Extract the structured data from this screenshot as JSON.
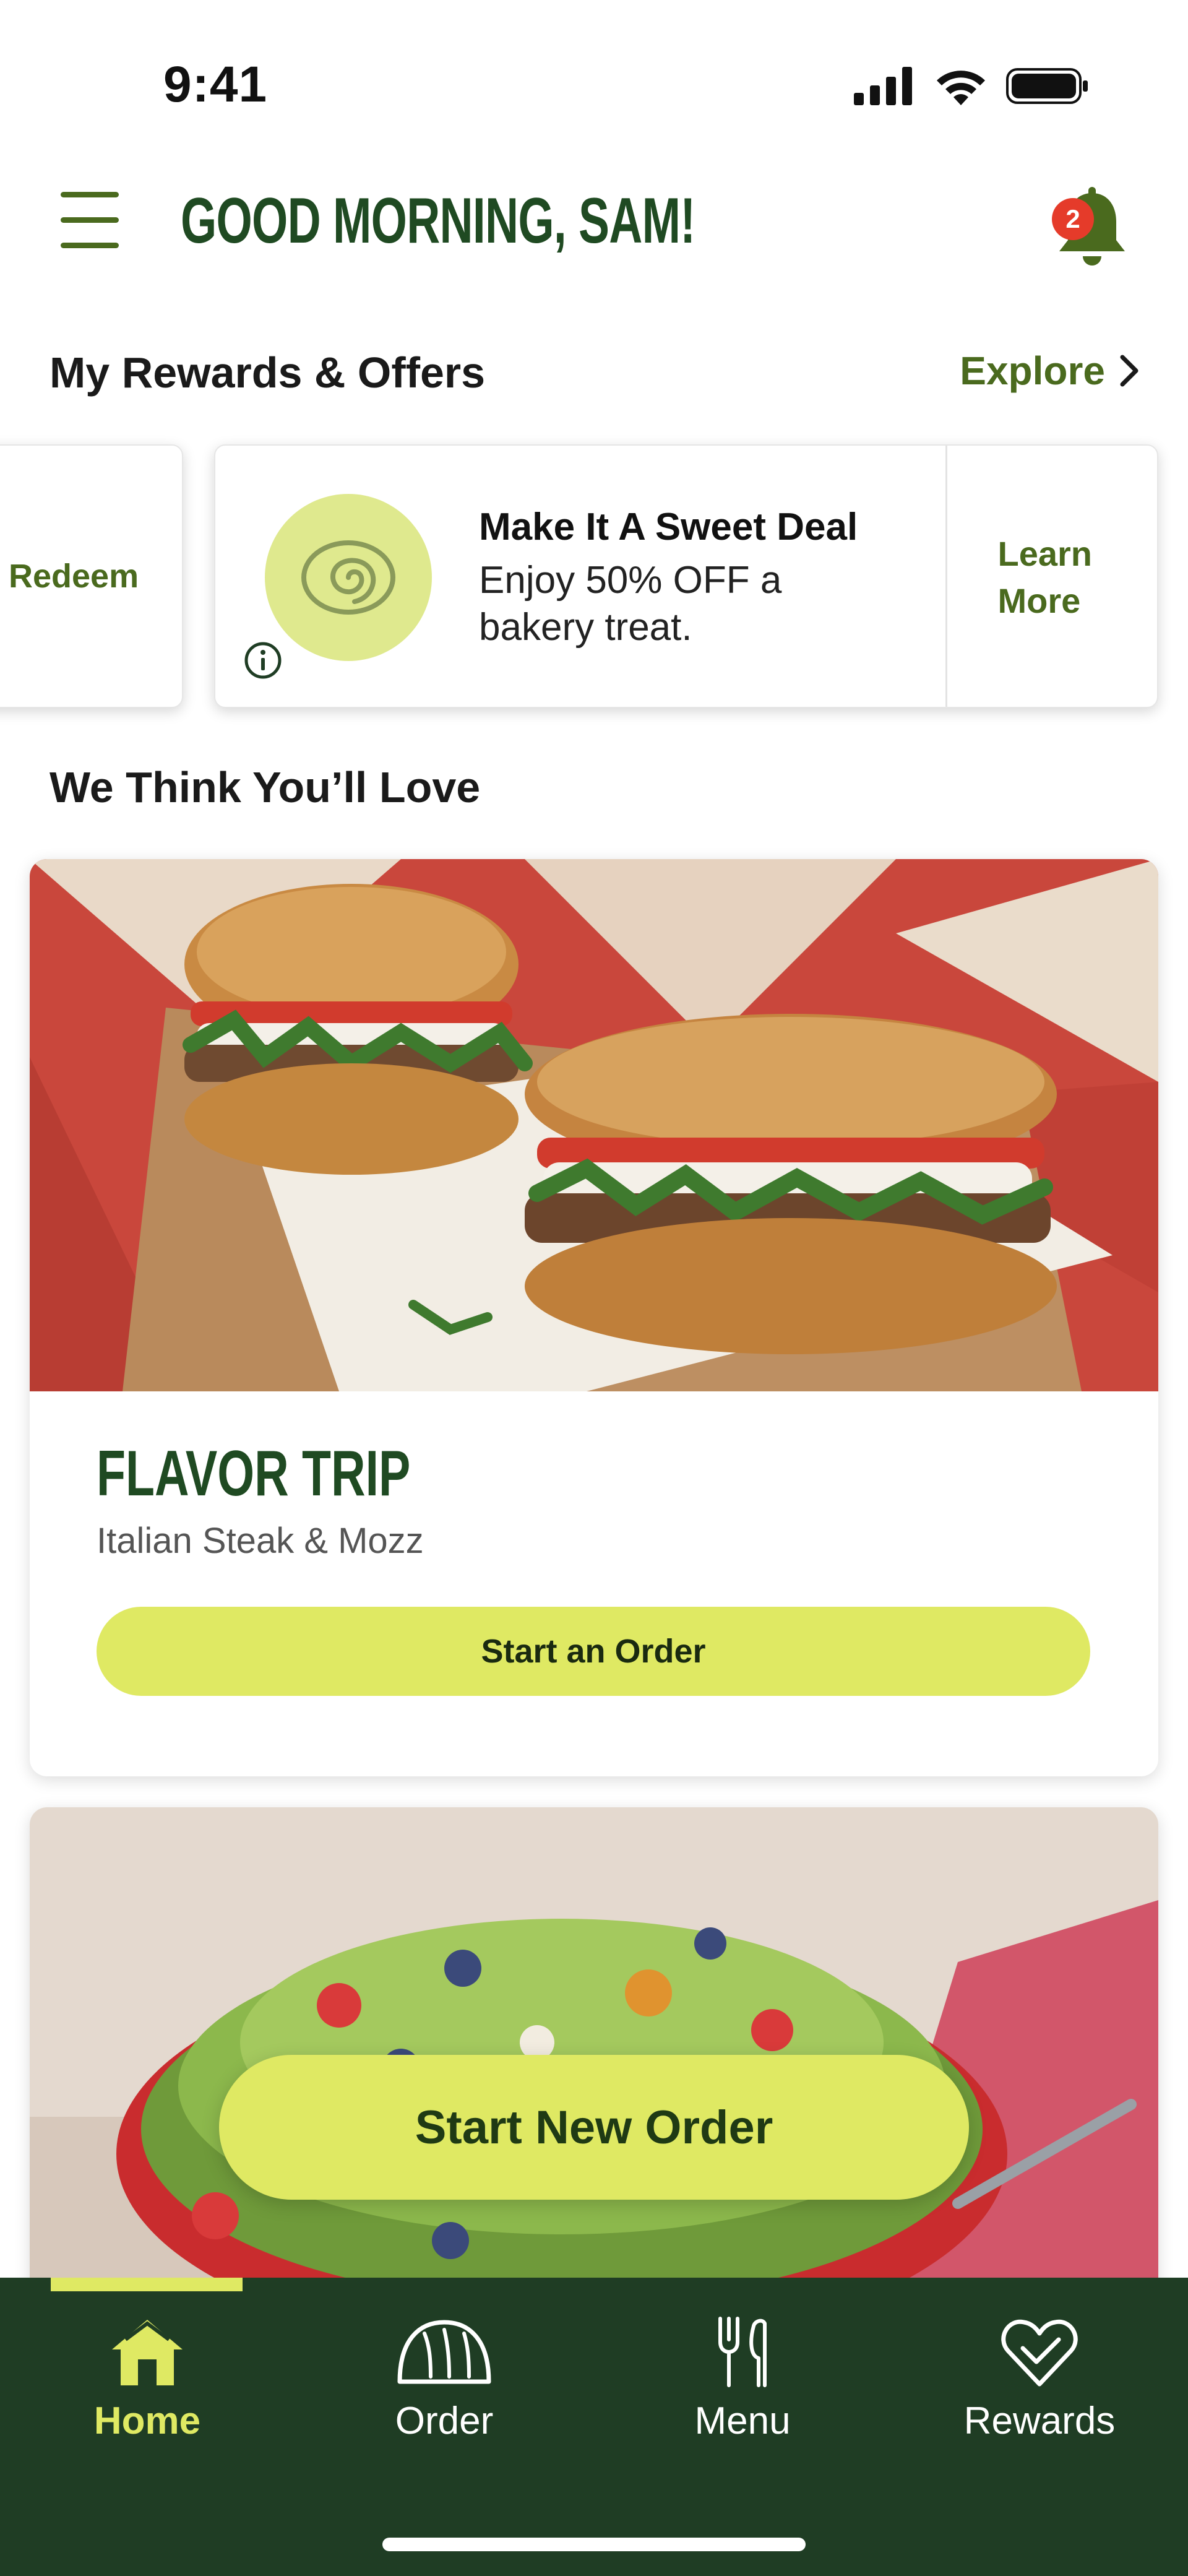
{
  "status_bar": {
    "time": "9:41"
  },
  "header": {
    "greeting": "GOOD MORNING, SAM!",
    "notification_count": "2"
  },
  "rewards": {
    "title": "My Rewards & Offers",
    "explore_label": "Explore",
    "left_card_action": "Redeem",
    "offer": {
      "title": "Make It A Sweet Deal",
      "description": "Enjoy 50% OFF a bakery treat.",
      "cta": "Learn More"
    }
  },
  "recommendations": {
    "title": "We Think You’ll Love",
    "cards": [
      {
        "tag": "FLAVOR TRIP",
        "subtitle": "Italian Steak & Mozz",
        "cta": "Start an Order"
      }
    ]
  },
  "floating_cta": "Start New Order",
  "bottom_nav": {
    "items": [
      {
        "label": "Home",
        "icon": "home-icon",
        "active": true
      },
      {
        "label": "Order",
        "icon": "bread-icon",
        "active": false
      },
      {
        "label": "Menu",
        "icon": "utensils-icon",
        "active": false
      },
      {
        "label": "Rewards",
        "icon": "heart-icon",
        "active": false
      }
    ]
  },
  "colors": {
    "brand_green": "#1f3d24",
    "accent_lime": "#dfe963",
    "link_green": "#4a6a1e",
    "badge_red": "#e53b2a"
  }
}
